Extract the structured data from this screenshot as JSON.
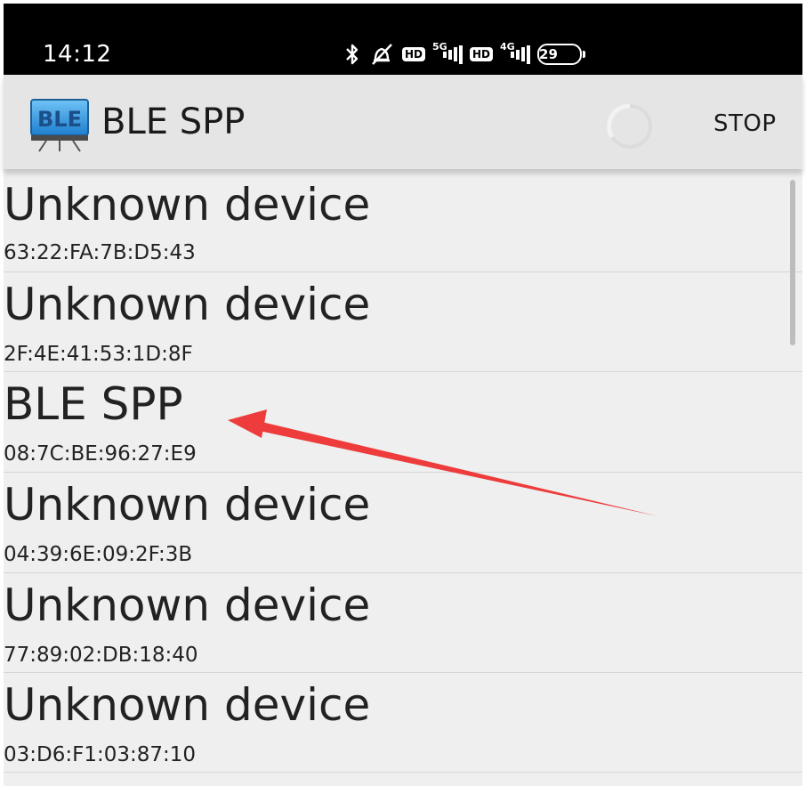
{
  "status_bar": {
    "time": "14:12",
    "icons": [
      "bluetooth-icon",
      "alarm-off-icon",
      "hd-icon",
      "signal-5g-icon",
      "hd-icon",
      "signal-4g-icon",
      "battery-icon"
    ],
    "hd_label": "HD",
    "net_5g": "5G",
    "net_4g": "4G",
    "battery_level": "29"
  },
  "action_bar": {
    "app_icon_label": "BLE",
    "title": "BLE SPP",
    "stop_label": "STOP",
    "progress_indicator": "loading-spinner-icon"
  },
  "devices": [
    {
      "name": "Unknown device",
      "address": "63:22:FA:7B:D5:43"
    },
    {
      "name": "Unknown device",
      "address": "2F:4E:41:53:1D:8F"
    },
    {
      "name": "BLE SPP",
      "address": "08:7C:BE:96:27:E9"
    },
    {
      "name": "Unknown device",
      "address": "04:39:6E:09:2F:3B"
    },
    {
      "name": "Unknown device",
      "address": "77:89:02:DB:18:40"
    },
    {
      "name": "Unknown device",
      "address": "03:D6:F1:03:87:10"
    }
  ],
  "colors": {
    "status_bar_bg": "#000000",
    "action_bar_bg": "#e5e5e5",
    "list_bg": "#efefef",
    "annotation_arrow": "#ee3b3b",
    "app_icon_blue": "#2f8fd8"
  }
}
